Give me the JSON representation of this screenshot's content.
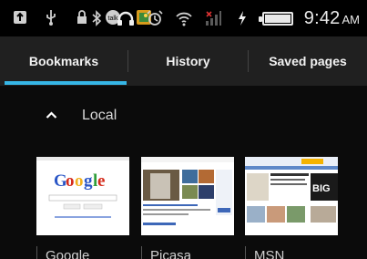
{
  "status_bar": {
    "left_icons": [
      "usb-icon",
      "lock-icon",
      "lock-icon",
      "chat-icon",
      "gallery-icon"
    ],
    "right_icons": [
      "bluetooth-icon",
      "headphones-icon",
      "alarm-icon",
      "wifi-icon",
      "signal-icon",
      "charging-icon",
      "battery-icon"
    ],
    "time": "9:42",
    "ampm": "AM"
  },
  "tabs": [
    {
      "label": "Bookmarks",
      "selected": true
    },
    {
      "label": "History",
      "selected": false
    },
    {
      "label": "Saved pages",
      "selected": false
    }
  ],
  "section": {
    "label": "Local",
    "expanded": true
  },
  "bookmarks": [
    {
      "label": "Google"
    },
    {
      "label": "Picasa"
    },
    {
      "label": "MSN"
    }
  ],
  "colors": {
    "accent": "#36b6e6",
    "tab_bar": "#202020",
    "background": "#0b0b0b"
  }
}
